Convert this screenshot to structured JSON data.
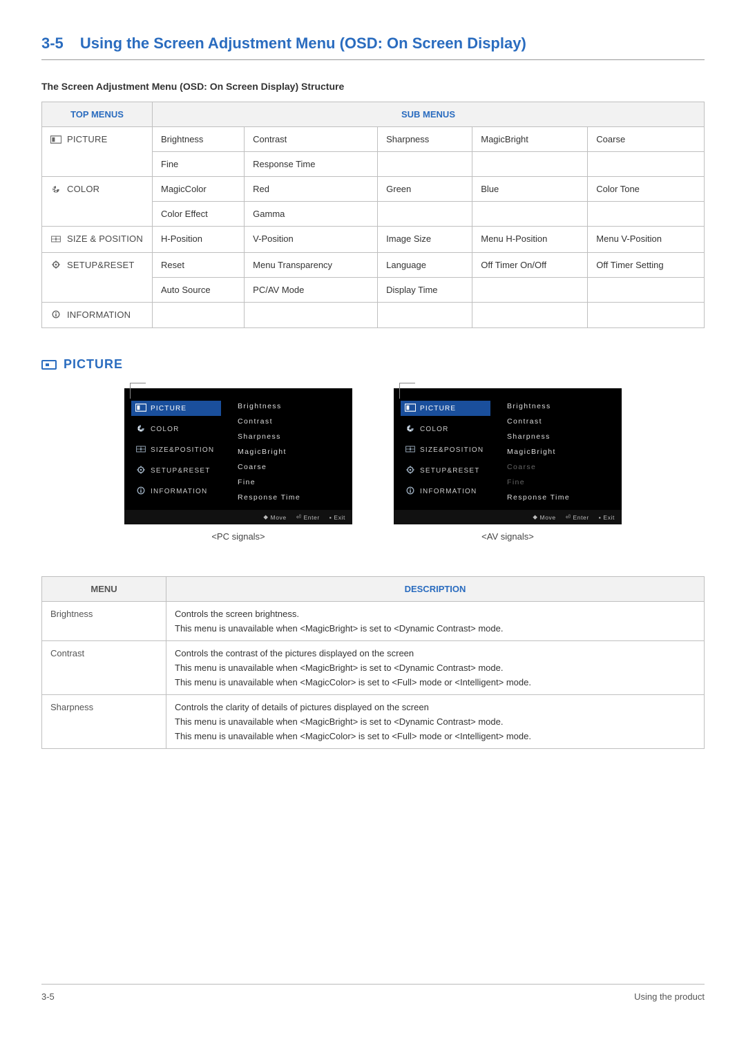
{
  "header": {
    "number": "3-5",
    "title": "Using the Screen Adjustment Menu (OSD: On Screen Display)"
  },
  "structure_heading": "The Screen Adjustment Menu (OSD: On Screen Display) Structure",
  "menu_table": {
    "headers": {
      "top": "TOP MENUS",
      "sub": "SUB MENUS"
    },
    "rows": [
      {
        "top": "PICTURE",
        "icon": "picture",
        "subs": [
          [
            "Brightness",
            "Contrast",
            "Sharpness",
            "MagicBright",
            "Coarse"
          ],
          [
            "Fine",
            "Response Time",
            "",
            "",
            ""
          ]
        ]
      },
      {
        "top": "COLOR",
        "icon": "color",
        "subs": [
          [
            "MagicColor",
            "Red",
            "Green",
            "Blue",
            "Color Tone"
          ],
          [
            "Color Effect",
            "Gamma",
            "",
            "",
            ""
          ]
        ]
      },
      {
        "top": "SIZE & POSITION",
        "icon": "size",
        "subs": [
          [
            "H-Position",
            "V-Position",
            "Image Size",
            "Menu H-Position",
            "Menu V-Position"
          ]
        ]
      },
      {
        "top": "SETUP&RESET",
        "icon": "setup",
        "subs": [
          [
            "Reset",
            "Menu Transparency",
            "Language",
            "Off Timer On/Off",
            "Off Timer Setting"
          ],
          [
            "Auto Source",
            "PC/AV Mode",
            "Display Time",
            "",
            ""
          ]
        ]
      },
      {
        "top": "INFORMATION",
        "icon": "info",
        "subs": [
          [
            "",
            "",
            "",
            "",
            ""
          ]
        ]
      }
    ]
  },
  "picture_heading": "PICTURE",
  "osd": {
    "left": [
      {
        "label": "PICTURE",
        "selected": true
      },
      {
        "label": "COLOR"
      },
      {
        "label": "SIZE&POSITION"
      },
      {
        "label": "SETUP&RESET"
      },
      {
        "label": "INFORMATION"
      }
    ],
    "right_pc": [
      {
        "label": "Brightness"
      },
      {
        "label": "Contrast"
      },
      {
        "label": "Sharpness"
      },
      {
        "label": "MagicBright"
      },
      {
        "label": "Coarse"
      },
      {
        "label": "Fine"
      },
      {
        "label": "Response Time"
      }
    ],
    "right_av": [
      {
        "label": "Brightness"
      },
      {
        "label": "Contrast"
      },
      {
        "label": "Sharpness"
      },
      {
        "label": "MagicBright"
      },
      {
        "label": "Coarse",
        "disabled": true
      },
      {
        "label": "Fine",
        "disabled": true
      },
      {
        "label": "Response Time"
      }
    ],
    "footer": {
      "move": "Move",
      "enter": "Enter",
      "exit": "Exit"
    },
    "caption_pc": "<PC signals>",
    "caption_av": "<AV signals>"
  },
  "desc_table": {
    "headers": {
      "menu": "MENU",
      "description": "DESCRIPTION"
    },
    "rows": [
      {
        "menu": "Brightness",
        "lines": [
          "Controls the screen brightness.",
          "This menu is unavailable when <MagicBright> is set to <Dynamic Contrast> mode."
        ]
      },
      {
        "menu": "Contrast",
        "lines": [
          "Controls the contrast of the pictures displayed on the screen",
          "This menu is unavailable when <MagicBright> is set to <Dynamic Contrast> mode.",
          "This menu is unavailable when <MagicColor> is set to <Full> mode or <Intelligent> mode."
        ]
      },
      {
        "menu": "Sharpness",
        "lines": [
          "Controls the clarity of details of pictures displayed on the screen",
          "This menu is unavailable when <MagicBright> is set to <Dynamic Contrast> mode.",
          "This menu is unavailable when <MagicColor> is set to <Full> mode or <Intelligent> mode."
        ]
      }
    ]
  },
  "footer": {
    "left": "3-5",
    "right": "Using the product"
  }
}
